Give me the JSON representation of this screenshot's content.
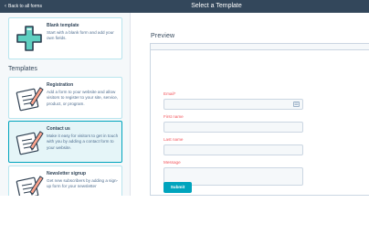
{
  "header": {
    "back_label": "Back to all forms",
    "title": "Select a Template"
  },
  "sidebar": {
    "blank": {
      "title": "Blank template",
      "description": "Start with a blank form and add your own fields.",
      "icon": "plus-icon"
    },
    "section_title": "Templates",
    "templates": [
      {
        "title": "Registration",
        "description": "Add a form to your website and allow visitors to register to your site, service, product, or program.",
        "icon": "clipboard-pencil-icon"
      },
      {
        "title": "Contact us",
        "description": "Make it easy for visitors to get in touch with you by adding a contact form to your website.",
        "icon": "clipboard-pencil-icon",
        "selected": true
      },
      {
        "title": "Newsletter signup",
        "description": "Get new subscribers by adding a sign-up form for your newsletter",
        "icon": "clipboard-pencil-icon"
      }
    ]
  },
  "preview": {
    "title": "Preview",
    "fields": [
      {
        "label": "Email*",
        "value": "",
        "icon": "keyboard-icon"
      },
      {
        "label": "First name",
        "value": ""
      },
      {
        "label": "Last name",
        "value": ""
      },
      {
        "label": "Message",
        "value": ""
      }
    ],
    "submit_label": "Submit"
  },
  "colors": {
    "header_bg": "#33475b",
    "accent": "#00a4bd",
    "selected_bg": "#e5f5f8",
    "required_label": "#f2545b",
    "input_bg": "#f5f8fa"
  }
}
